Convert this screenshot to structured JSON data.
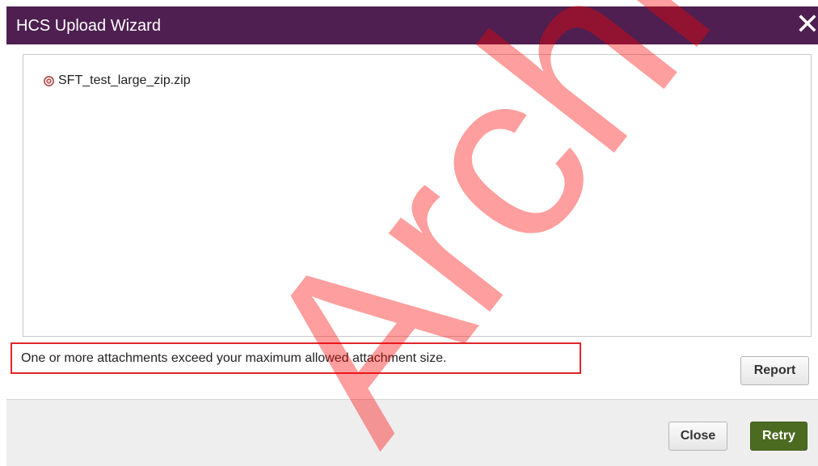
{
  "dialog": {
    "title": "HCS Upload Wizard",
    "close_glyph": "✕",
    "accent_color": "#4e1f50"
  },
  "file_list": {
    "items": [
      {
        "name": "SFT_test_large_zip.zip",
        "status_icon": "error-circle-icon",
        "status_color": "#b0413e"
      }
    ]
  },
  "message": {
    "text": "One or more attachments exceed your maximum allowed attachment size.",
    "highlight_color": "#e0262a"
  },
  "buttons": {
    "report_label": "Report",
    "close_label": "Close",
    "retry_label": "Retry",
    "retry_color": "#4b6b20"
  },
  "watermark": {
    "text": "Archive",
    "color": "#ff0000"
  }
}
